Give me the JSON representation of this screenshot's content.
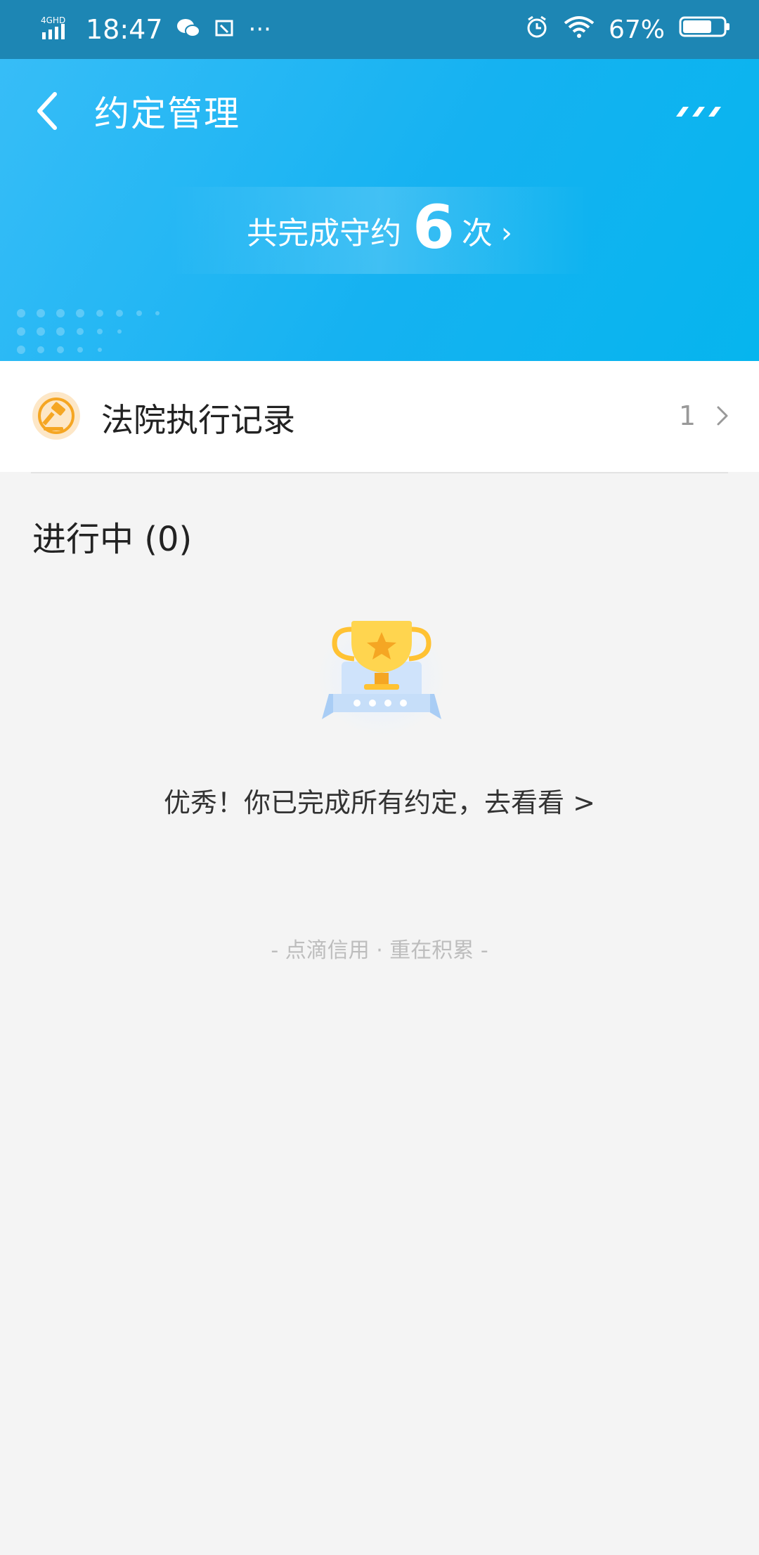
{
  "status_bar": {
    "network": "4G HD",
    "time": "18:47",
    "battery": "67%",
    "icons": [
      "signal-icon",
      "wechat-icon",
      "screenshot-icon",
      "more-dots-icon",
      "alarm-icon",
      "wifi-icon",
      "battery-icon"
    ]
  },
  "header": {
    "title": "约定管理",
    "completed_prefix": "共完成守约",
    "completed_count": "6",
    "completed_suffix": "次",
    "chevron": "›"
  },
  "record_row": {
    "label": "法院执行记录",
    "count": "1",
    "icon": "gavel-icon"
  },
  "section": {
    "title": "进行中 (0)"
  },
  "empty_state": {
    "message": "优秀！你已完成所有约定，去看看 >",
    "icon": "trophy-icon"
  },
  "footer": {
    "slogan": "- 点滴信用 · 重在积累 -"
  },
  "colors": {
    "header_start": "#37bdf7",
    "header_end": "#06b5ee",
    "accent_orange": "#f5a623",
    "trophy_gold": "#ffd54f"
  }
}
